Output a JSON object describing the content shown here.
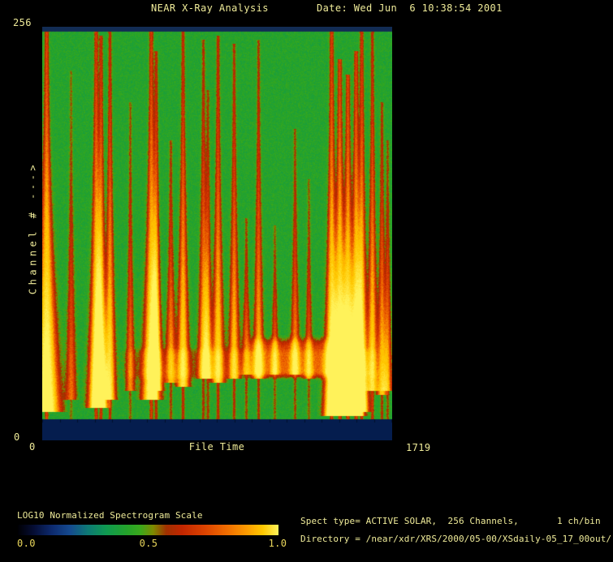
{
  "header": {
    "title": "NEAR X-Ray Analysis",
    "date": "Date: Wed Jun  6 10:38:54 2001"
  },
  "axes": {
    "y_label": "Channel # --->",
    "y_max": "256",
    "y_min": "0",
    "x_label": "File Time",
    "x_min": "0",
    "x_max": "1719"
  },
  "colorbar": {
    "title": "LOG10 Normalized Spectrogram Scale",
    "tick_labels": [
      "0.0",
      "0.5",
      "1.0"
    ],
    "gradient_stops": [
      {
        "pos": 0.0,
        "color": "#000004"
      },
      {
        "pos": 0.06,
        "color": "#050d33"
      },
      {
        "pos": 0.13,
        "color": "#0d2a6e"
      },
      {
        "pos": 0.2,
        "color": "#154a8f"
      },
      {
        "pos": 0.27,
        "color": "#0d7a74"
      },
      {
        "pos": 0.34,
        "color": "#0f9a50"
      },
      {
        "pos": 0.42,
        "color": "#25a32a"
      },
      {
        "pos": 0.47,
        "color": "#3aa81c"
      },
      {
        "pos": 0.52,
        "color": "#7e8a00"
      },
      {
        "pos": 0.57,
        "color": "#a03000"
      },
      {
        "pos": 0.63,
        "color": "#c22600"
      },
      {
        "pos": 0.72,
        "color": "#dd4400"
      },
      {
        "pos": 0.8,
        "color": "#f06c00"
      },
      {
        "pos": 0.88,
        "color": "#fc9c00"
      },
      {
        "pos": 0.94,
        "color": "#ffc800"
      },
      {
        "pos": 1.0,
        "color": "#fff25a"
      }
    ]
  },
  "info": {
    "line1": "Spect type= ACTIVE SOLAR,  256 Channels,       1 ch/bin",
    "line2": "Directory = /near/xdr/XRS/2000/05-00/XSdaily-05_17_00out/"
  },
  "colors": {
    "background": "#000000",
    "text": "#efeb99",
    "gold": "#ead75b",
    "band_top": "#122c54",
    "band_bottom": "#051d4e",
    "tick": "#02102c"
  },
  "chart_data": {
    "type": "heatmap",
    "title": "NEAR X-Ray Analysis",
    "xlabel": "File Time",
    "ylabel": "Channel #",
    "xlim": [
      0,
      1719
    ],
    "ylim": [
      0,
      256
    ],
    "colorbar_label": "LOG10 Normalized Spectrogram Scale",
    "colorbar_range": [
      0.0,
      1.0
    ],
    "x_minor_tick_count": 20,
    "background_level": 0.42,
    "flares": [
      {
        "t": 20,
        "w": 70,
        "i": 1.0,
        "top": 0.0,
        "base": 0.93
      },
      {
        "t": 140,
        "w": 26,
        "i": 0.4,
        "top": 0.1,
        "base": 0.9
      },
      {
        "t": 263,
        "w": 40,
        "i": 0.88,
        "top": 0.0,
        "base": 0.92
      },
      {
        "t": 287,
        "w": 32,
        "i": 0.8,
        "top": 0.01,
        "base": 0.92
      },
      {
        "t": 331,
        "w": 26,
        "i": 0.72,
        "top": 0.0,
        "base": 0.9
      },
      {
        "t": 431,
        "w": 20,
        "i": 0.45,
        "top": 0.18,
        "base": 0.88
      },
      {
        "t": 534,
        "w": 46,
        "i": 0.92,
        "top": 0.0,
        "base": 0.9
      },
      {
        "t": 558,
        "w": 24,
        "i": 0.7,
        "top": 0.05,
        "base": 0.88
      },
      {
        "t": 630,
        "w": 26,
        "i": 0.55,
        "top": 0.28,
        "base": 0.86
      },
      {
        "t": 690,
        "w": 30,
        "i": 0.72,
        "top": 0.0,
        "base": 0.87
      },
      {
        "t": 790,
        "w": 26,
        "i": 0.6,
        "top": 0.02,
        "base": 0.85
      },
      {
        "t": 812,
        "w": 20,
        "i": 0.55,
        "top": 0.15,
        "base": 0.85
      },
      {
        "t": 862,
        "w": 30,
        "i": 0.7,
        "top": 0.01,
        "base": 0.86
      },
      {
        "t": 941,
        "w": 26,
        "i": 0.62,
        "top": 0.03,
        "base": 0.85
      },
      {
        "t": 1001,
        "w": 22,
        "i": 0.5,
        "top": 0.48,
        "base": 0.84
      },
      {
        "t": 1061,
        "w": 24,
        "i": 0.57,
        "top": 0.02,
        "base": 0.85
      },
      {
        "t": 1141,
        "w": 18,
        "i": 0.45,
        "top": 0.5,
        "base": 0.84
      },
      {
        "t": 1240,
        "w": 22,
        "i": 0.5,
        "top": 0.25,
        "base": 0.84
      },
      {
        "t": 1308,
        "w": 18,
        "i": 0.42,
        "top": 0.38,
        "base": 0.85
      },
      {
        "t": 1420,
        "w": 38,
        "i": 0.95,
        "top": 0.0,
        "base": 0.94
      },
      {
        "t": 1460,
        "w": 46,
        "i": 1.0,
        "top": 0.07,
        "base": 0.94
      },
      {
        "t": 1500,
        "w": 46,
        "i": 1.0,
        "top": 0.11,
        "base": 0.94
      },
      {
        "t": 1540,
        "w": 38,
        "i": 0.95,
        "top": 0.05,
        "base": 0.94
      },
      {
        "t": 1568,
        "w": 30,
        "i": 0.85,
        "top": 0.0,
        "base": 0.93
      },
      {
        "t": 1620,
        "w": 24,
        "i": 0.7,
        "top": 0.0,
        "base": 0.88
      },
      {
        "t": 1667,
        "w": 22,
        "i": 0.6,
        "top": 0.18,
        "base": 0.89
      },
      {
        "t": 1695,
        "w": 18,
        "i": 0.5,
        "top": 0.28,
        "base": 0.88
      }
    ]
  }
}
